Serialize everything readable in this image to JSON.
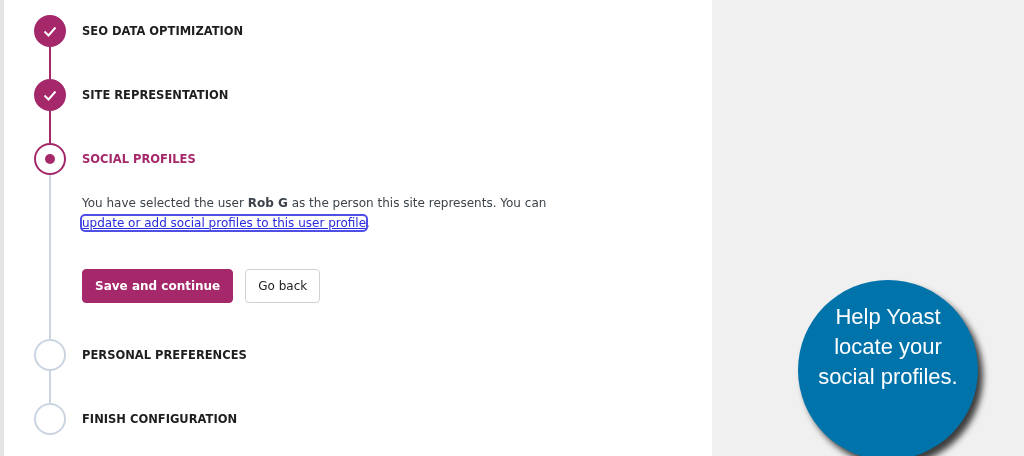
{
  "steps": [
    {
      "label": "SEO DATA OPTIMIZATION",
      "completed": true,
      "current": false
    },
    {
      "label": "SITE REPRESENTATION",
      "completed": true,
      "current": false
    },
    {
      "label": "SOCIAL PROFILES",
      "completed": false,
      "current": true,
      "description": {
        "text": "You have selected the user **Rob G** as the person this site represents. You can ",
        "link": "update or add social profiles to this user profile",
        "end": "."
      },
      "buttons": [
        {
          "label": "Save and continue",
          "kind": "primary"
        },
        {
          "label": "Go back",
          "kind": "secondary"
        }
      ]
    },
    {
      "label": "PERSONAL PREFERENCES",
      "completed": false,
      "current": false
    },
    {
      "label": "FINISH CONFIGURATION",
      "completed": false,
      "current": false
    }
  ],
  "callout": {
    "text": "Help Yoast locate your social profiles."
  }
}
